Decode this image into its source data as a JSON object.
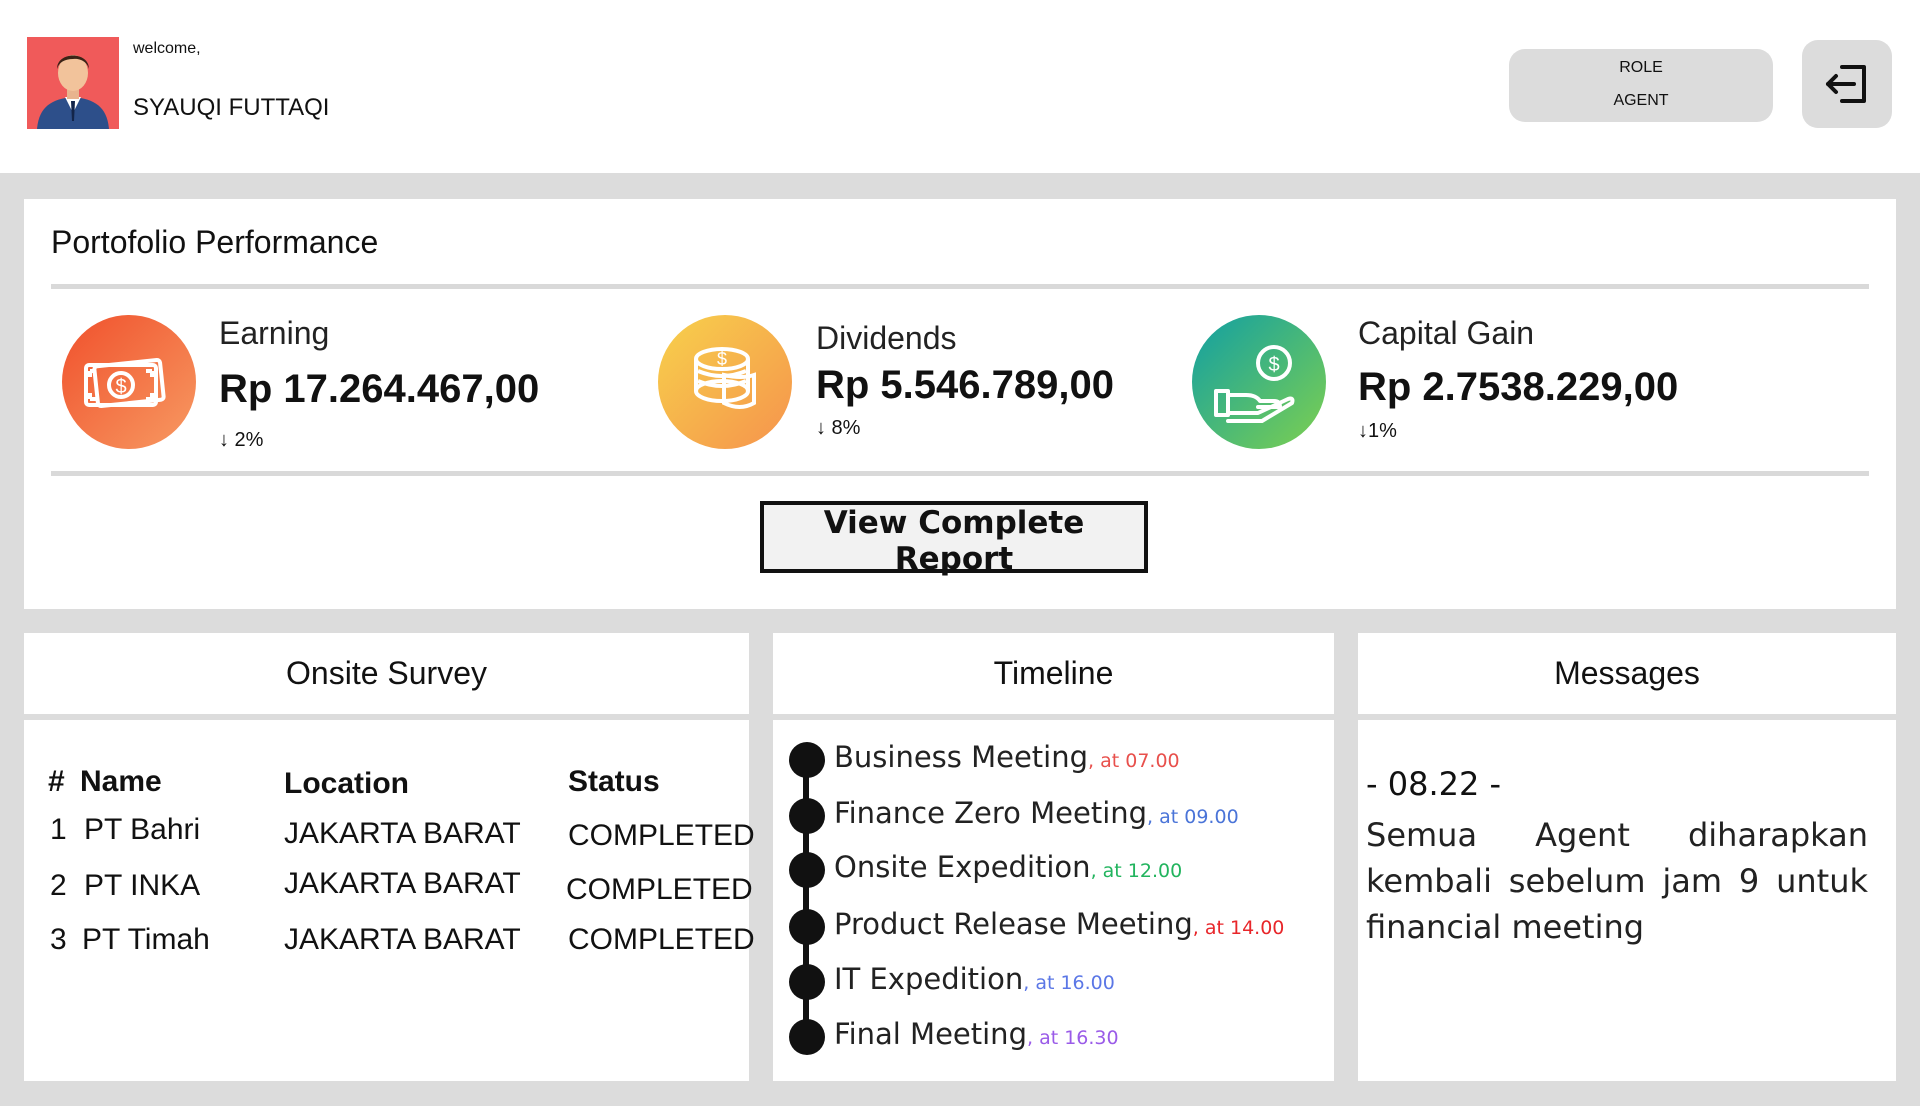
{
  "header": {
    "welcome": "welcome,",
    "username": "SYAUQI FUTTAQI",
    "role_label": "ROLE",
    "role_value": "AGENT",
    "logout_icon": "logout-icon"
  },
  "portfolio": {
    "title": "Portofolio Performance",
    "metrics": [
      {
        "label": "Earning",
        "value": "Rp 17.264.467,00",
        "change": "↓ 2%",
        "icon": "money-bill-icon",
        "colors": [
          "#f0502c",
          "#f79a62"
        ]
      },
      {
        "label": "Dividends",
        "value": "Rp 5.546.789,00",
        "change": "↓ 8%",
        "icon": "coins-stack-icon",
        "colors": [
          "#f7d14b",
          "#f6934d"
        ]
      },
      {
        "label": "Capital Gain",
        "value": "Rp 2.7538.229,00",
        "change": "↓1%",
        "icon": "hand-dollar-icon",
        "colors": [
          "#119fa3",
          "#7ed04f"
        ]
      }
    ],
    "report_button": "View Complete Report"
  },
  "survey": {
    "title": "Onsite Survey",
    "headers": {
      "num": "#",
      "name": "Name",
      "location": "Location",
      "status": "Status"
    },
    "rows": [
      {
        "num": "1",
        "name": "PT Bahri",
        "location": "JAKARTA BARAT",
        "status": "COMPLETED"
      },
      {
        "num": "2",
        "name": "PT INKA",
        "location": "JAKARTA BARAT",
        "status": "COMPLETED"
      },
      {
        "num": "3",
        "name": "PT Timah",
        "location": "JAKARTA BARAT",
        "status": "COMPLETED"
      }
    ]
  },
  "timeline": {
    "title": "Timeline",
    "items": [
      {
        "event": "Business Meeting",
        "time": ", at 07.00",
        "color": "#e8504c"
      },
      {
        "event": "Finance Zero Meeting",
        "time": ", at 09.00",
        "color": "#4a74d8"
      },
      {
        "event": "Onsite Expedition",
        "time": ", at 12.00",
        "color": "#22b45e"
      },
      {
        "event": "Product Release Meeting",
        "time": ", at 14.00",
        "color": "#e8262a"
      },
      {
        "event": "IT Expedition",
        "time": ", at 16.00",
        "color": "#5b77e6"
      },
      {
        "event": "Final Meeting",
        "time": ", at 16.30",
        "color": "#9a5be8"
      }
    ]
  },
  "messages": {
    "title": "Messages",
    "time": "- 08.22 -",
    "text": "Semua Agent diharapkan kembali sebelum jam 9 untuk financial meeting"
  }
}
